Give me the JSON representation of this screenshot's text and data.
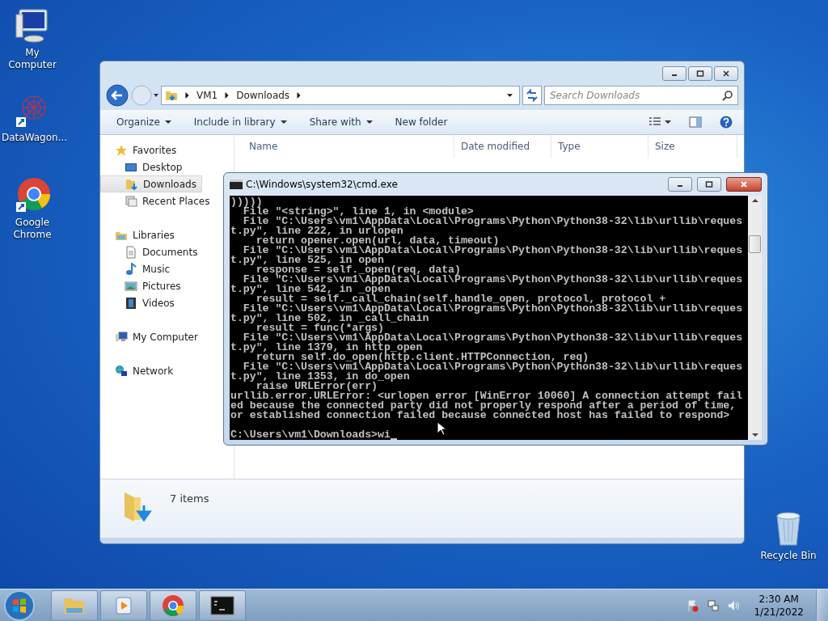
{
  "desktop_icons": [
    {
      "label": "My Computer",
      "kind": "computer"
    },
    {
      "label": "DataWagon...",
      "kind": "datawagon"
    },
    {
      "label": "Google Chrome",
      "kind": "chrome"
    },
    {
      "label": "Recycle Bin",
      "kind": "recycle"
    }
  ],
  "explorer": {
    "breadcrumb": [
      "VM1",
      "Downloads"
    ],
    "search": {
      "placeholder": "Search Downloads"
    },
    "toolbar": [
      {
        "label": "Organize",
        "dropdown": true
      },
      {
        "label": "Include in library",
        "dropdown": true
      },
      {
        "label": "Share with",
        "dropdown": true
      },
      {
        "label": "New folder",
        "dropdown": false
      }
    ],
    "columns": [
      "Name",
      "Date modified",
      "Type",
      "Size"
    ],
    "nav": [
      {
        "label": "Favorites",
        "kind": "star",
        "selected": false,
        "children": [
          {
            "label": "Desktop",
            "kind": "desktop",
            "selected": false
          },
          {
            "label": "Downloads",
            "kind": "downloads",
            "selected": true
          },
          {
            "label": "Recent Places",
            "kind": "recent",
            "selected": false
          }
        ]
      },
      {
        "label": "Libraries",
        "kind": "library",
        "selected": false,
        "children": [
          {
            "label": "Documents",
            "kind": "document",
            "selected": false
          },
          {
            "label": "Music",
            "kind": "music",
            "selected": false
          },
          {
            "label": "Pictures",
            "kind": "pictures",
            "selected": false
          },
          {
            "label": "Videos",
            "kind": "videos",
            "selected": false
          }
        ]
      },
      {
        "label": "My Computer",
        "kind": "computer",
        "selected": false
      },
      {
        "label": "Network",
        "kind": "network",
        "selected": false
      }
    ],
    "status": "7 items"
  },
  "cmd": {
    "title": "C:\\Windows\\system32\\cmd.exe",
    "lines": [
      ")))))",
      "  File \"<string>\", line 1, in <module>",
      "  File \"C:\\Users\\vm1\\AppData\\Local\\Programs\\Python\\Python38-32\\lib\\urllib\\reques",
      "t.py\", line 222, in urlopen",
      "    return opener.open(url, data, timeout)",
      "  File \"C:\\Users\\vm1\\AppData\\Local\\Programs\\Python\\Python38-32\\lib\\urllib\\reques",
      "t.py\", line 525, in open",
      "    response = self._open(req, data)",
      "  File \"C:\\Users\\vm1\\AppData\\Local\\Programs\\Python\\Python38-32\\lib\\urllib\\reques",
      "t.py\", line 542, in _open",
      "    result = self._call_chain(self.handle_open, protocol, protocol +",
      "  File \"C:\\Users\\vm1\\AppData\\Local\\Programs\\Python\\Python38-32\\lib\\urllib\\reques",
      "t.py\", line 502, in _call_chain",
      "    result = func(*args)",
      "  File \"C:\\Users\\vm1\\AppData\\Local\\Programs\\Python\\Python38-32\\lib\\urllib\\reques",
      "t.py\", line 1379, in http_open",
      "    return self.do_open(http.client.HTTPConnection, req)",
      "  File \"C:\\Users\\vm1\\AppData\\Local\\Programs\\Python\\Python38-32\\lib\\urllib\\reques",
      "t.py\", line 1353, in do_open",
      "    raise URLError(err)",
      "urllib.error.URLError: <urlopen error [WinError 10060] A connection attempt fail",
      "ed because the connected party did not properly respond after a period of time,",
      "or established connection failed because connected host has failed to respond>"
    ],
    "prompt": "C:\\Users\\vm1\\Downloads>wi"
  },
  "taskbar": {
    "buttons": [
      {
        "kind": "explorer"
      },
      {
        "kind": "media"
      },
      {
        "kind": "chrome"
      },
      {
        "kind": "console"
      }
    ],
    "time": "2:30 AM",
    "date": "1/21/2022"
  }
}
